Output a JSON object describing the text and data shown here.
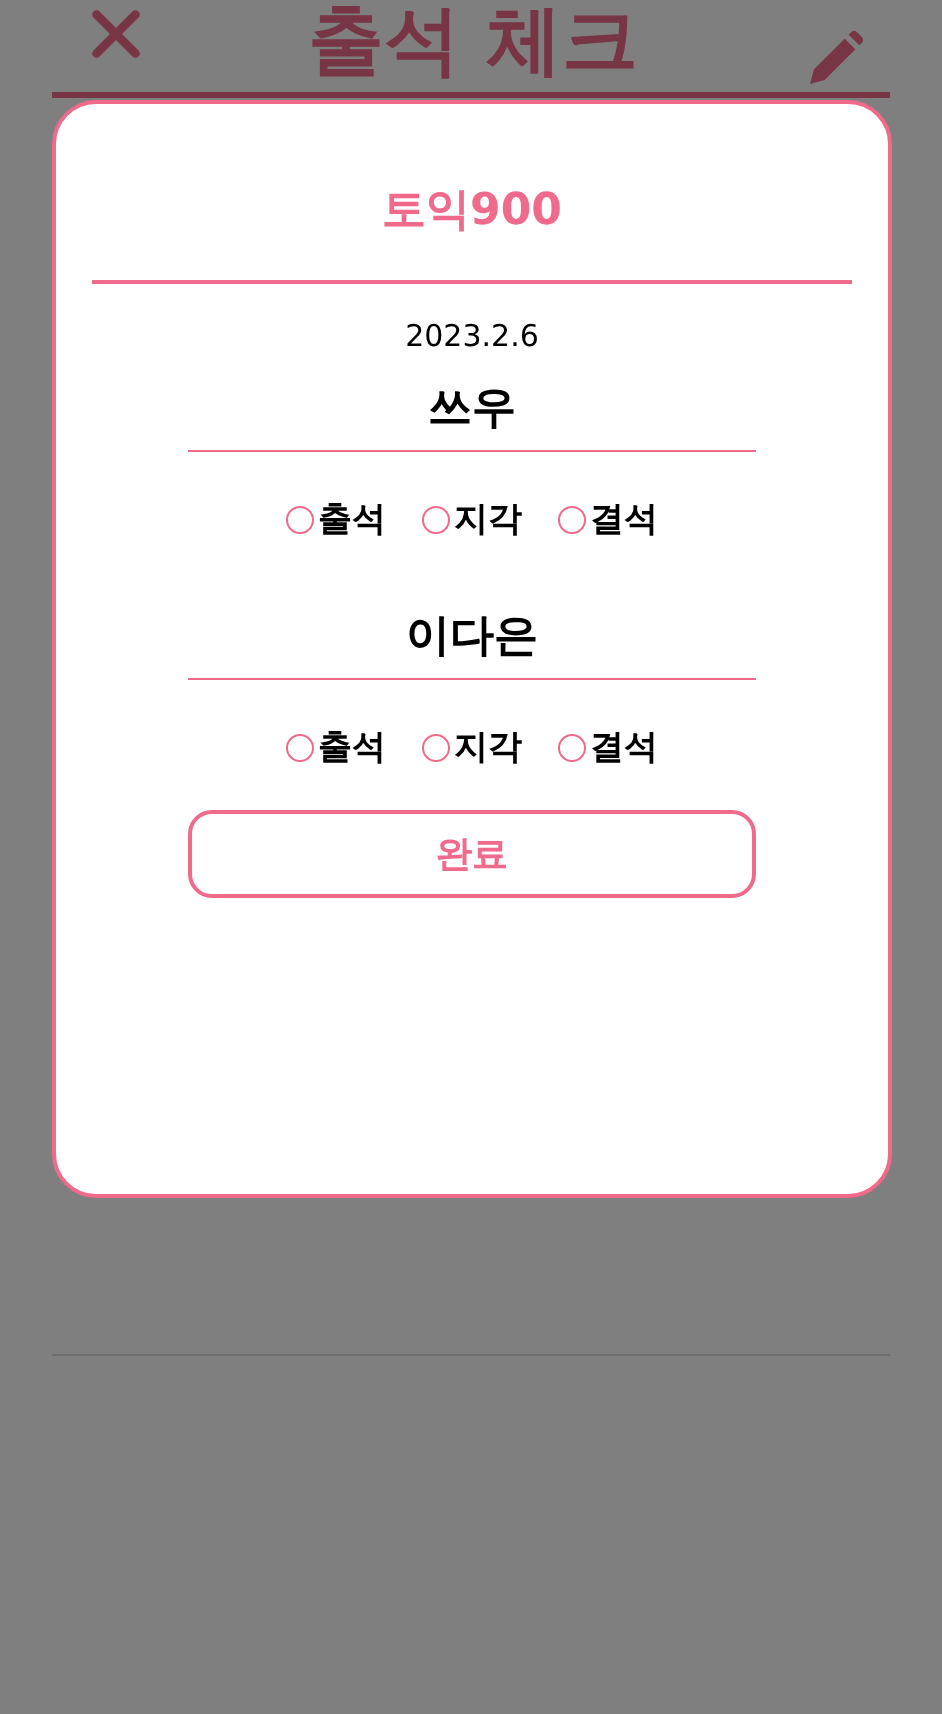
{
  "header": {
    "title": "출석 체크"
  },
  "modal": {
    "title": "토익900",
    "date": "2023.2.6",
    "students": [
      {
        "name": "쓰우",
        "options": [
          {
            "label": "출석",
            "selected": false
          },
          {
            "label": "지각",
            "selected": false
          },
          {
            "label": "결석",
            "selected": false
          }
        ]
      },
      {
        "name": "이다은",
        "options": [
          {
            "label": "출석",
            "selected": false
          },
          {
            "label": "지각",
            "selected": false
          },
          {
            "label": "결석",
            "selected": false
          }
        ]
      }
    ],
    "submit": "완료"
  }
}
